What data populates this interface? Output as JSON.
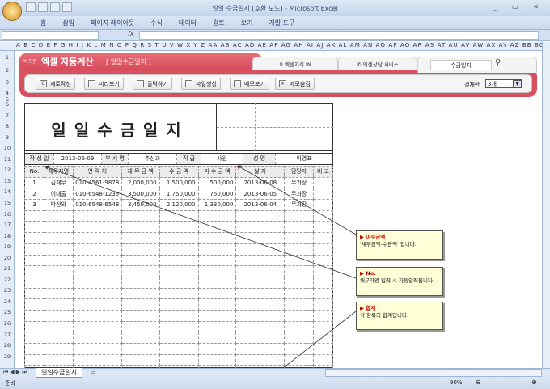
{
  "window": {
    "title": "일일 수금일지  [호환 모드] - Microsoft Excel",
    "controls": "_ ▭ ✕"
  },
  "ribbon": {
    "tabs": [
      "홈",
      "삽입",
      "페이지 레이아웃",
      "수식",
      "데이터",
      "검토",
      "보기",
      "개발 도구"
    ]
  },
  "formula_bar": {
    "fx": "fx",
    "value": ""
  },
  "columns": "A B C D E F G H I J K L M N O P Q R S T U V W X Y Z AA AB AC AD AE AF AG AH AI AJ AK AL AM AN AO AP AQ AR AS AT AU AV AW AX AY AZ BB BC",
  "banner": {
    "brand_small": "비즈폼",
    "brand": "엑셀 자동계산",
    "subtitle": "[ 일일수금일지 ]",
    "tab1": "엑셀지식 IN",
    "tab2": "엑셀상담 서비스",
    "search_value": "수금일지",
    "buttons": [
      "새로작성",
      "미리보기",
      "출력하기",
      "파일생성",
      "메모보기",
      "메모숨김"
    ],
    "approval_label": "결재란",
    "approval_value": "3개"
  },
  "sheet": {
    "title": "일일수금일지",
    "info": {
      "date_label": "작 성 일",
      "date": "2013-06-09",
      "dept_label": "부 서 명",
      "dept": "추심과",
      "rank_label": "직  급",
      "rank": "사원",
      "name_label": "성  명",
      "name": "이영표"
    },
    "headers": [
      "No.",
      "채무자명",
      "연 락 처",
      "채 무 금 액",
      "수 금 액",
      "미 수 금 액",
      "날      자",
      "담당자",
      "비 고"
    ],
    "rows": [
      [
        "1",
        "김채무",
        "010-4561-9878",
        "2,000,000",
        "1,500,000",
        "500,000",
        "2013-06-08",
        "무과장",
        ""
      ],
      [
        "2",
        "이대출",
        "010-6548-1235",
        "3,500,000",
        "1,750,000",
        "750,000",
        "2013-06-05",
        "무과장",
        ""
      ],
      [
        "3",
        "박산와",
        "010-6548-6548",
        "3,450,000",
        "2,120,000",
        "1,330,000",
        "2013-06-04",
        "무과장",
        ""
      ]
    ]
  },
  "notes": [
    {
      "title": "미수금액",
      "body": "'채무금액-수금액' 입니다."
    },
    {
      "title": "No.",
      "body": "채무자명 입력 시 자동입력됩니다."
    },
    {
      "title": "합계",
      "body": "각 항목의 합계입니다."
    }
  ],
  "sheet_tabs": {
    "active": "일일수금일지"
  },
  "status": {
    "ready": "준비",
    "zoom": "90%"
  }
}
